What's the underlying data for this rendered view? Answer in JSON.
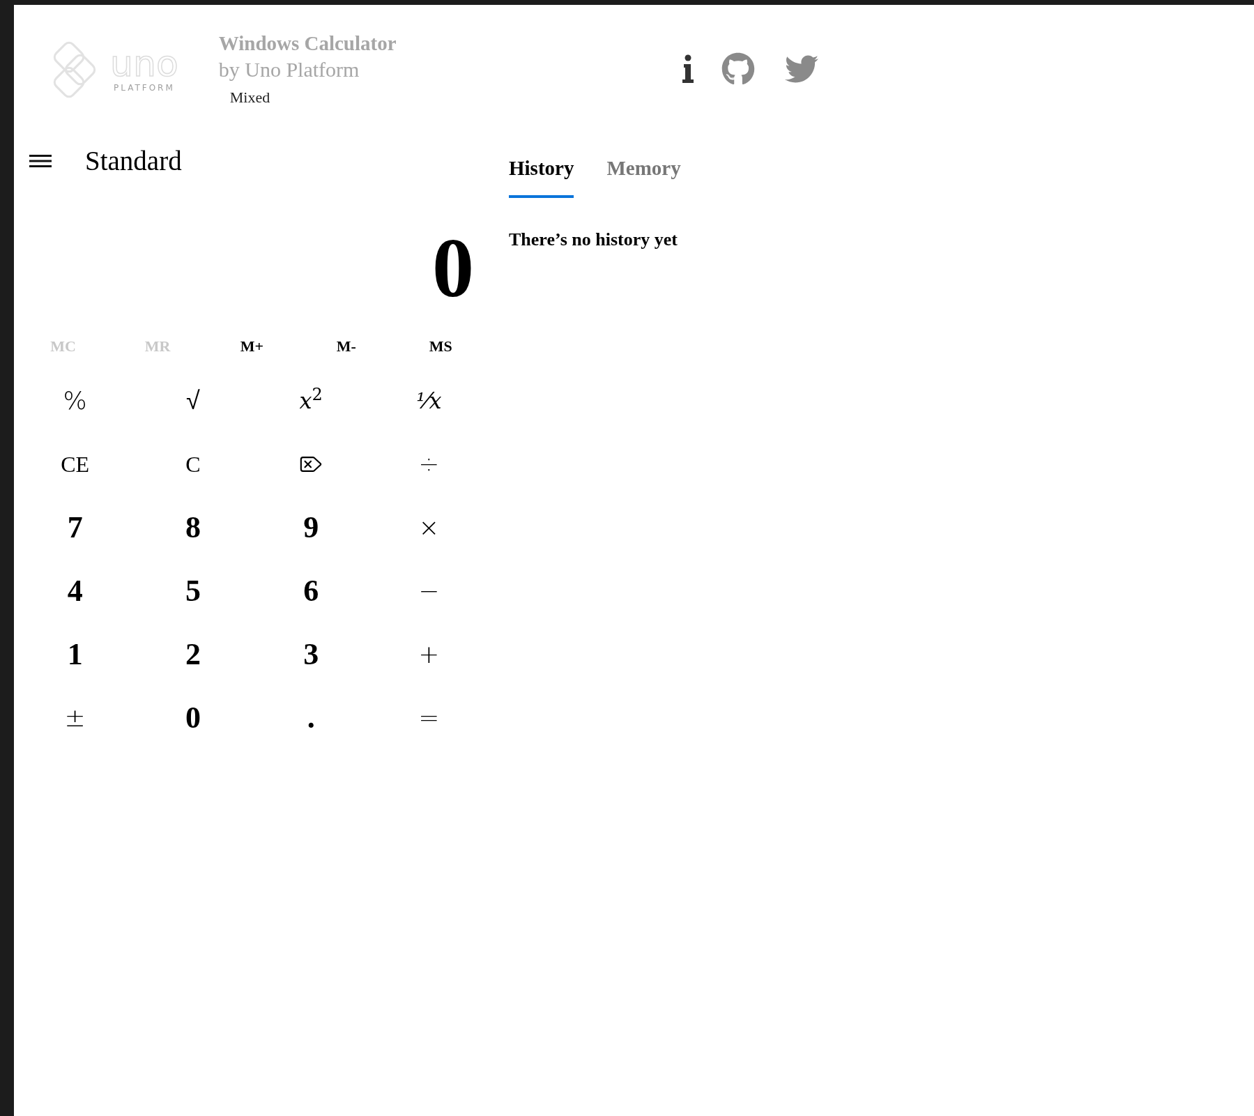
{
  "header": {
    "logo": {
      "wordmark": "uno",
      "tagline": "PLATFORM"
    },
    "title": "Windows Calculator",
    "subtitle": "by Uno Platform",
    "mode_label": "Mixed"
  },
  "mode": {
    "title": "Standard"
  },
  "display": {
    "value": "0"
  },
  "memory_buttons": [
    {
      "label": "MC",
      "disabled": true
    },
    {
      "label": "MR",
      "disabled": true
    },
    {
      "label": "M+",
      "disabled": false
    },
    {
      "label": "M-",
      "disabled": false
    },
    {
      "label": "MS",
      "disabled": false
    }
  ],
  "keys": [
    {
      "kind": "op",
      "label": "%"
    },
    {
      "kind": "op",
      "label": "√"
    },
    {
      "kind": "rich",
      "label": "*x*$^{2}$"
    },
    {
      "kind": "italic",
      "label": "⅟x"
    },
    {
      "kind": "text",
      "label": "CE"
    },
    {
      "kind": "text",
      "label": "C"
    },
    {
      "kind": "backspace"
    },
    {
      "kind": "op",
      "label": "÷"
    },
    {
      "kind": "digit",
      "label": "7"
    },
    {
      "kind": "digit",
      "label": "8"
    },
    {
      "kind": "digit",
      "label": "9"
    },
    {
      "kind": "op",
      "label": "×"
    },
    {
      "kind": "digit",
      "label": "4"
    },
    {
      "kind": "digit",
      "label": "5"
    },
    {
      "kind": "digit",
      "label": "6"
    },
    {
      "kind": "op",
      "label": "−"
    },
    {
      "kind": "digit",
      "label": "1"
    },
    {
      "kind": "digit",
      "label": "2"
    },
    {
      "kind": "digit",
      "label": "3"
    },
    {
      "kind": "op",
      "label": "+"
    },
    {
      "kind": "op",
      "label": "±"
    },
    {
      "kind": "digit",
      "label": "0"
    },
    {
      "kind": "digit",
      "label": "."
    },
    {
      "kind": "op",
      "label": "="
    }
  ],
  "tabs": [
    {
      "label": "History",
      "selected": true
    },
    {
      "label": "Memory",
      "selected": false
    }
  ],
  "history": {
    "empty_message": "There’s no history yet"
  }
}
